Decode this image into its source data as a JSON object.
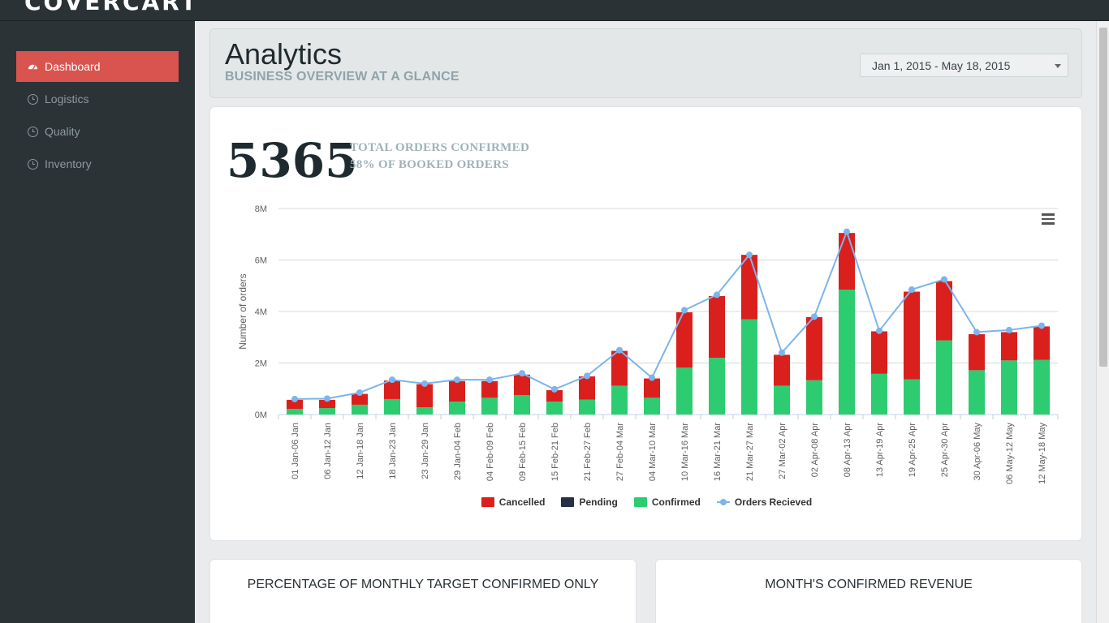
{
  "app": {
    "logo": "COVERCART"
  },
  "sidebar": {
    "items": [
      {
        "label": "Dashboard",
        "icon": "dashboard-icon",
        "active": true
      },
      {
        "label": "Logistics",
        "icon": "clock-icon",
        "active": false
      },
      {
        "label": "Quality",
        "icon": "clock-icon",
        "active": false
      },
      {
        "label": "Inventory",
        "icon": "clock-icon",
        "active": false
      }
    ]
  },
  "header": {
    "title": "Analytics",
    "subtitle": "BUSINESS OVERVIEW AT A GLANCE",
    "date_range": "Jan 1, 2015 - May 18, 2015"
  },
  "summary": {
    "total": "5365",
    "line1": "TOTAL ORDERS CONFIRMED",
    "line2": "58% OF BOOKED ORDERS"
  },
  "chart_data": {
    "type": "bar",
    "stacked": true,
    "ylabel": "Number of orders",
    "ylim": [
      0,
      8
    ],
    "y_ticks": [
      "0M",
      "2M",
      "4M",
      "6M",
      "8M"
    ],
    "grid": true,
    "legend_position": "bottom",
    "categories": [
      "01 Jan-06 Jan",
      "06 Jan-12 Jan",
      "12 Jan-18 Jan",
      "18 Jan-23 Jan",
      "23 Jan-29 Jan",
      "29 Jan-04 Feb",
      "04 Feb-09 Feb",
      "09 Feb-15 Feb",
      "15 Feb-21 Feb",
      "21 Feb-27 Feb",
      "27 Feb-04 Mar",
      "04 Mar-10 Mar",
      "10 Mar-16 Mar",
      "16 Mar-21 Mar",
      "21 Mar-27 Mar",
      "27 Mar-02 Apr",
      "02 Apr-08 Apr",
      "08 Apr-13 Apr",
      "13 Apr-19 Apr",
      "19 Apr-25 Apr",
      "25 Apr-30 Apr",
      "30 Apr-06 May",
      "06 May-12 May",
      "12 May-18 May"
    ],
    "series": [
      {
        "name": "Cancelled",
        "color": "#d9201d",
        "values": [
          0.35,
          0.32,
          0.42,
          0.72,
          0.9,
          0.8,
          0.65,
          0.8,
          0.45,
          0.9,
          1.35,
          0.75,
          2.15,
          2.4,
          2.5,
          1.2,
          2.45,
          2.2,
          1.65,
          3.4,
          2.3,
          1.4,
          1.1,
          1.3
        ]
      },
      {
        "name": "Pending",
        "color": "#263147",
        "values": [
          0,
          0,
          0,
          0,
          0,
          0,
          0,
          0,
          0,
          0,
          0,
          0,
          0,
          0,
          0,
          0,
          0,
          0,
          0,
          0,
          0,
          0,
          0,
          0
        ]
      },
      {
        "name": "Confirmed",
        "color": "#2ecc71",
        "values": [
          0.22,
          0.25,
          0.38,
          0.6,
          0.28,
          0.5,
          0.65,
          0.75,
          0.5,
          0.58,
          1.12,
          0.65,
          1.82,
          2.2,
          3.7,
          1.12,
          1.33,
          4.85,
          1.58,
          1.37,
          2.88,
          1.72,
          2.1,
          2.12
        ]
      },
      {
        "name": "Orders Recieved",
        "color": "#7cb5ec",
        "type": "line",
        "values": [
          0.6,
          0.62,
          0.85,
          1.35,
          1.2,
          1.35,
          1.35,
          1.6,
          0.98,
          1.5,
          2.5,
          1.43,
          4.05,
          4.65,
          6.2,
          2.4,
          3.8,
          7.1,
          3.25,
          4.85,
          5.25,
          3.2,
          3.28,
          3.45
        ]
      }
    ]
  },
  "cards": {
    "left_title": "PERCENTAGE OF MONTHLY TARGET CONFIRMED ONLY",
    "right_title": "MONTH'S CONFIRMED REVENUE"
  }
}
